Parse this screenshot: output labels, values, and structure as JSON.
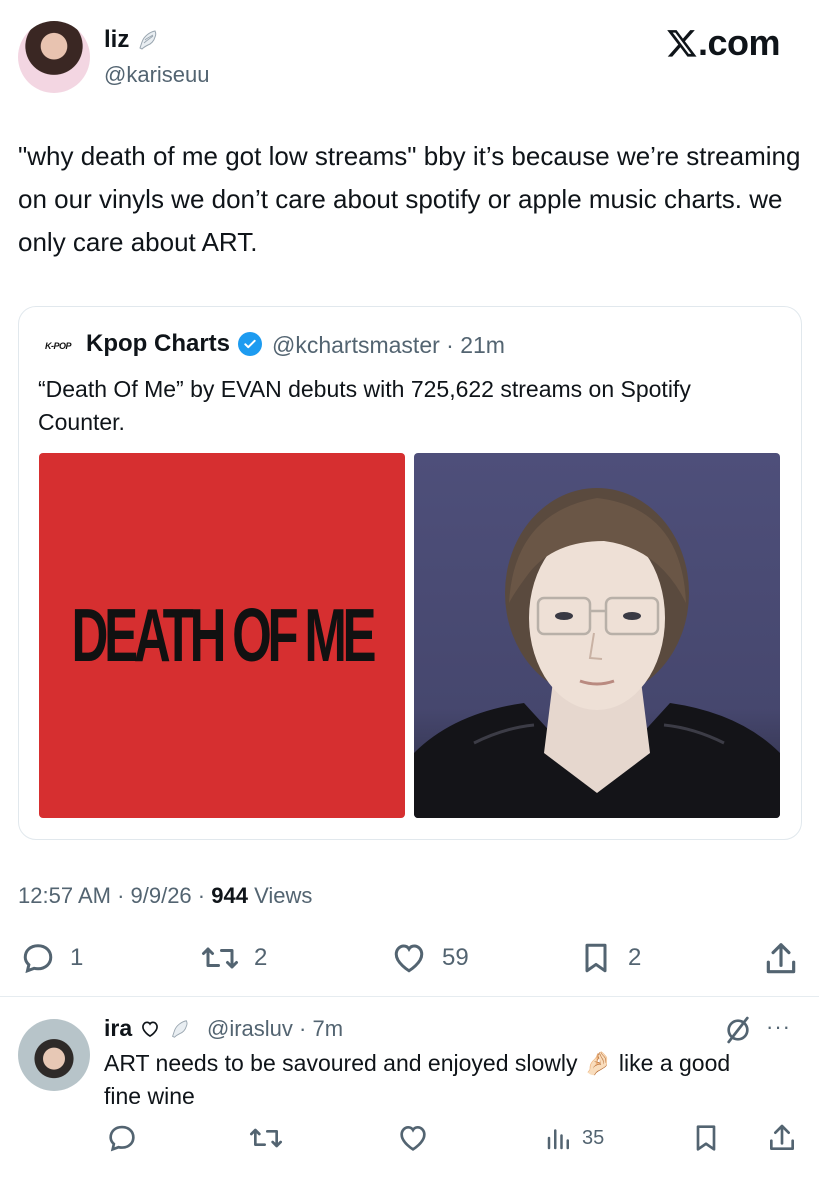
{
  "header": {
    "display_name": "liz",
    "handle": "@kariseuu",
    "site": ".com"
  },
  "tweet": {
    "text": "\"why death of me got low streams\" bby it’s because we’re streaming on our vinyls we don’t care about spotify or apple music charts. we only care about ART."
  },
  "quote": {
    "logo_text": "K-POP",
    "name": "Kpop Charts",
    "handle_time": "@kchartsmaster · 21m",
    "text": "“Death Of Me” by EVAN debuts with 725,622 streams on Spotify Counter.",
    "cover_title": "DEATH OF ME"
  },
  "meta": {
    "time": "12:57 AM · 9/9/26 · ",
    "views_count": "944",
    "views_label": " Views"
  },
  "actions": {
    "replies": "1",
    "reposts": "2",
    "likes": "59",
    "bookmarks": "2"
  },
  "reply": {
    "name": "ira",
    "handle_time": "@irasluv · 7m",
    "text": "ART needs to be savoured and enjoyed slowly 🤌🏻 like a good fine wine",
    "views": "35"
  },
  "colors": {
    "text": "#0f1419",
    "secondary": "#536471",
    "verified": "#1d9bf0",
    "cover_red": "#d62f30"
  }
}
